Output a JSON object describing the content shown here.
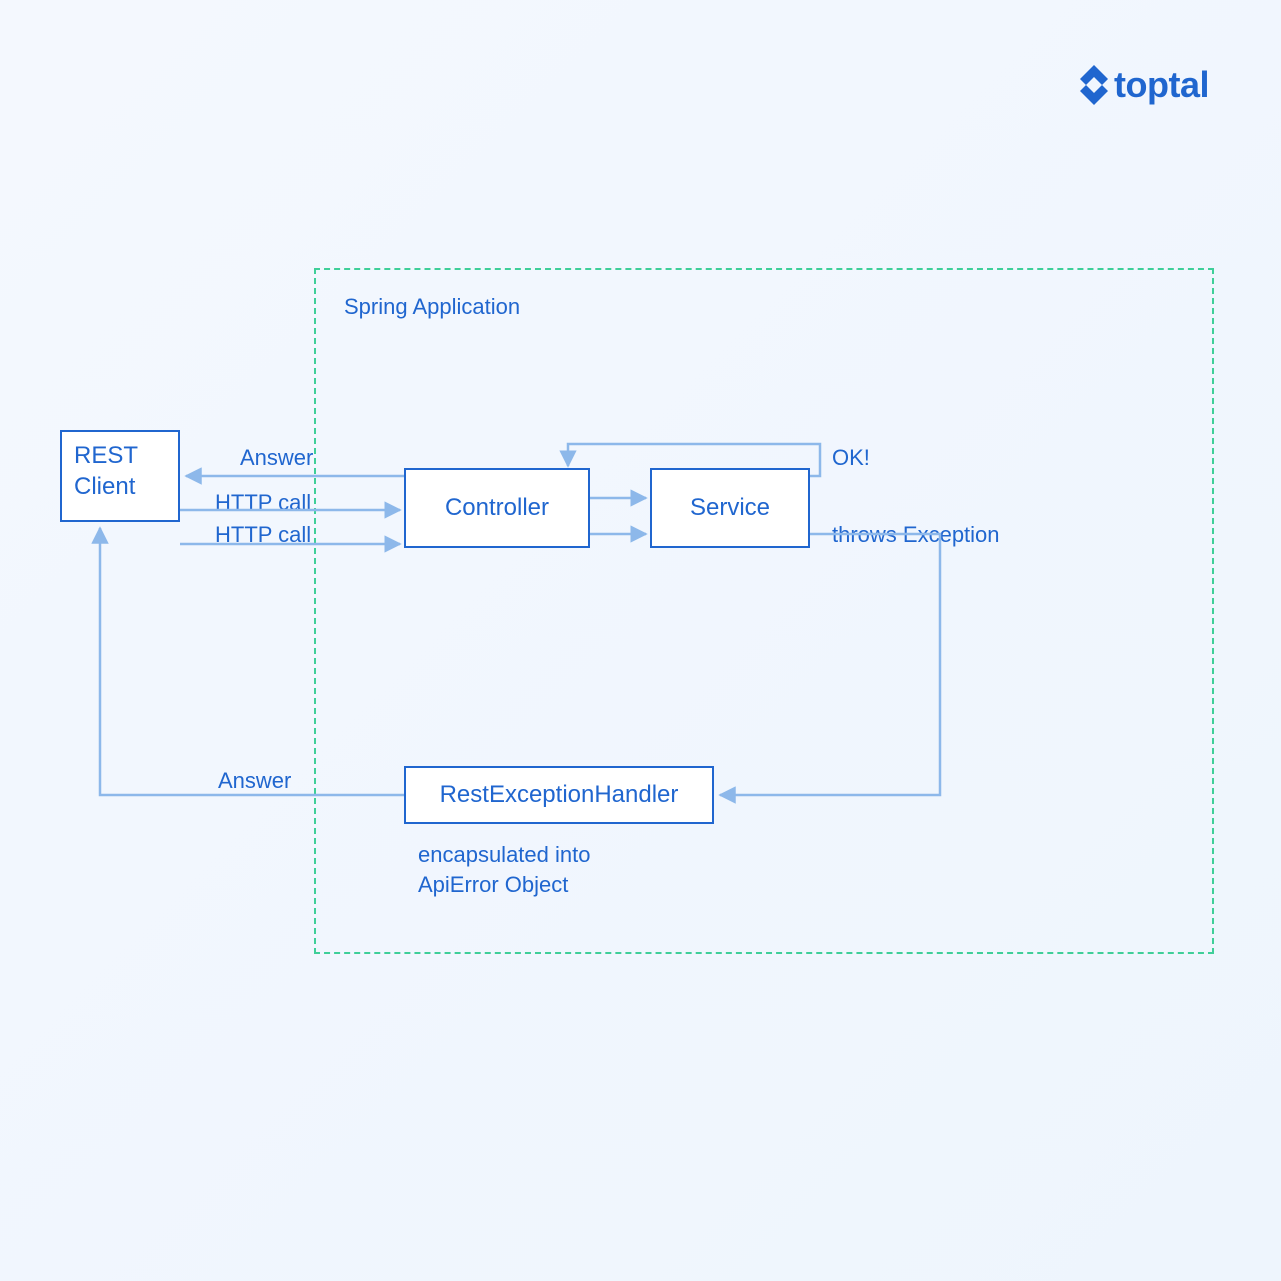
{
  "brand": {
    "name": "toptal"
  },
  "container": {
    "title": "Spring Application"
  },
  "nodes": {
    "rest_client": "REST\nClient",
    "controller": "Controller",
    "service": "Service",
    "handler": "RestExceptionHandler"
  },
  "edges": {
    "answer_top": "Answer",
    "http_call_1": "HTTP call",
    "http_call_2": "HTTP call",
    "ok": "OK!",
    "throws": "throws Exception",
    "answer_bottom": "Answer",
    "encapsulated": "encapsulated into\nApiError Object"
  },
  "colors": {
    "blue": "#2066cf",
    "lightBlue": "#8db8ea",
    "green": "#3fcf99",
    "bg": "#f2f7fe"
  }
}
